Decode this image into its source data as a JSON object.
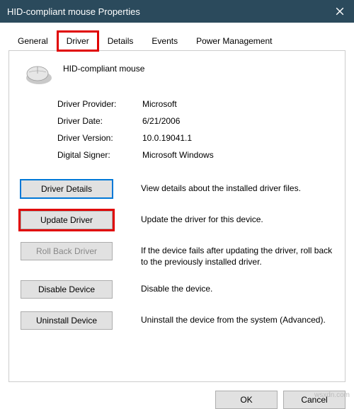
{
  "window": {
    "title": "HID-compliant mouse Properties"
  },
  "tabs": {
    "general": "General",
    "driver": "Driver",
    "details": "Details",
    "events": "Events",
    "power": "Power Management"
  },
  "device": {
    "name": "HID-compliant mouse"
  },
  "info": {
    "provider_label": "Driver Provider:",
    "provider_value": "Microsoft",
    "date_label": "Driver Date:",
    "date_value": "6/21/2006",
    "version_label": "Driver Version:",
    "version_value": "10.0.19041.1",
    "signer_label": "Digital Signer:",
    "signer_value": "Microsoft Windows"
  },
  "buttons": {
    "details": "Driver Details",
    "update": "Update Driver",
    "rollback": "Roll Back Driver",
    "disable": "Disable Device",
    "uninstall": "Uninstall Device",
    "ok": "OK",
    "cancel": "Cancel"
  },
  "descriptions": {
    "details": "View details about the installed driver files.",
    "update": "Update the driver for this device.",
    "rollback": "If the device fails after updating the driver, roll back to the previously installed driver.",
    "disable": "Disable the device.",
    "uninstall": "Uninstall the device from the system (Advanced)."
  },
  "watermark": "wsxdn.com"
}
